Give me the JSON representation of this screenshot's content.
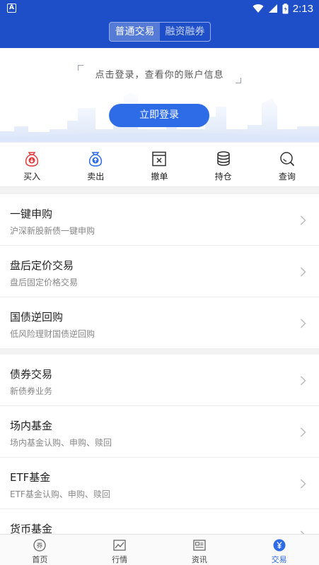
{
  "status_bar": {
    "time": "2:13",
    "left_badge": "A"
  },
  "header": {
    "tabs": [
      {
        "label": "普通交易",
        "active": true
      },
      {
        "label": "融资融券",
        "active": false
      }
    ]
  },
  "banner": {
    "hint": "点击登录，查看你的账户信息",
    "login_button": "立即登录"
  },
  "quick_actions": [
    {
      "label": "买入",
      "icon": "buy-bag-icon",
      "color": "#e23a3a"
    },
    {
      "label": "卖出",
      "icon": "sell-bag-icon",
      "color": "#2e6be6"
    },
    {
      "label": "撤单",
      "icon": "cancel-order-icon",
      "color": "#333333"
    },
    {
      "label": "持仓",
      "icon": "coin-stack-icon",
      "color": "#333333"
    },
    {
      "label": "查询",
      "icon": "search-icon",
      "color": "#333333"
    }
  ],
  "section1": [
    {
      "title": "一键申购",
      "subtitle": "沪深新股新债一键申购"
    },
    {
      "title": "盘后定价交易",
      "subtitle": "盘后固定价格交易"
    },
    {
      "title": "国债逆回购",
      "subtitle": "低风险理财国债逆回购"
    }
  ],
  "section2": [
    {
      "title": "债券交易",
      "subtitle": "新债券业务"
    },
    {
      "title": "场内基金",
      "subtitle": "场内基金认购、申购、赎回"
    },
    {
      "title": "ETF基金",
      "subtitle": "ETF基金认购、申购、赎回"
    },
    {
      "title": "货币基金",
      "subtitle": ""
    }
  ],
  "bottom_nav": [
    {
      "label": "首页",
      "icon": "home-coupon-icon",
      "active": false
    },
    {
      "label": "行情",
      "icon": "market-chart-icon",
      "active": false
    },
    {
      "label": "资讯",
      "icon": "news-icon",
      "active": false
    },
    {
      "label": "交易",
      "icon": "trade-yen-icon",
      "active": true
    }
  ],
  "colors": {
    "primary": "#1e4fc9",
    "accent": "#2e6be6",
    "buy": "#e23a3a"
  }
}
